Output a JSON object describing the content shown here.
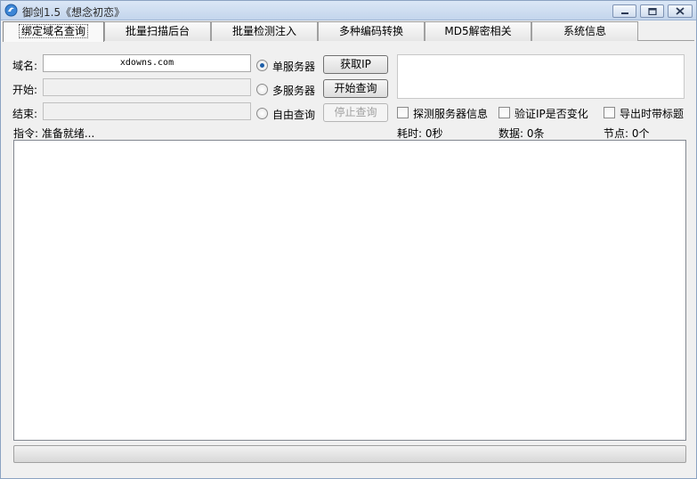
{
  "window": {
    "title": "御剑1.5《想念初恋》",
    "controls": {
      "minimize": "minimize-icon",
      "maximize": "maximize-icon",
      "close": "close-icon"
    }
  },
  "tabs": [
    {
      "label": "绑定域名查询",
      "active": true
    },
    {
      "label": "批量扫描后台",
      "active": false
    },
    {
      "label": "批量检测注入",
      "active": false
    },
    {
      "label": "多种编码转换",
      "active": false
    },
    {
      "label": "MD5解密相关",
      "active": false
    },
    {
      "label": "系统信息",
      "active": false
    }
  ],
  "form": {
    "domain_label": "域名:",
    "domain_value": "xdowns.com",
    "start_label": "开始:",
    "start_value": "",
    "end_label": "结束:",
    "end_value": ""
  },
  "mode": {
    "single_server": "单服务器",
    "multi_server": "多服务器",
    "free_query": "自由查询",
    "selected": "single_server"
  },
  "buttons": {
    "get_ip": "获取IP",
    "start_query": "开始查询",
    "stop_query": "停止查询"
  },
  "options": {
    "probe_server": "探测服务器信息",
    "verify_ip": "验证IP是否变化",
    "export_title": "导出时带标题"
  },
  "status": {
    "command": "指令: 准备就绪...",
    "elapsed": "耗时: 0秒",
    "data": "数据: 0条",
    "nodes": "节点: 0个"
  },
  "progress": {
    "value": 0
  },
  "colors": {
    "accent": "#1d5ea8",
    "progress_fill": "#3bb23b"
  }
}
